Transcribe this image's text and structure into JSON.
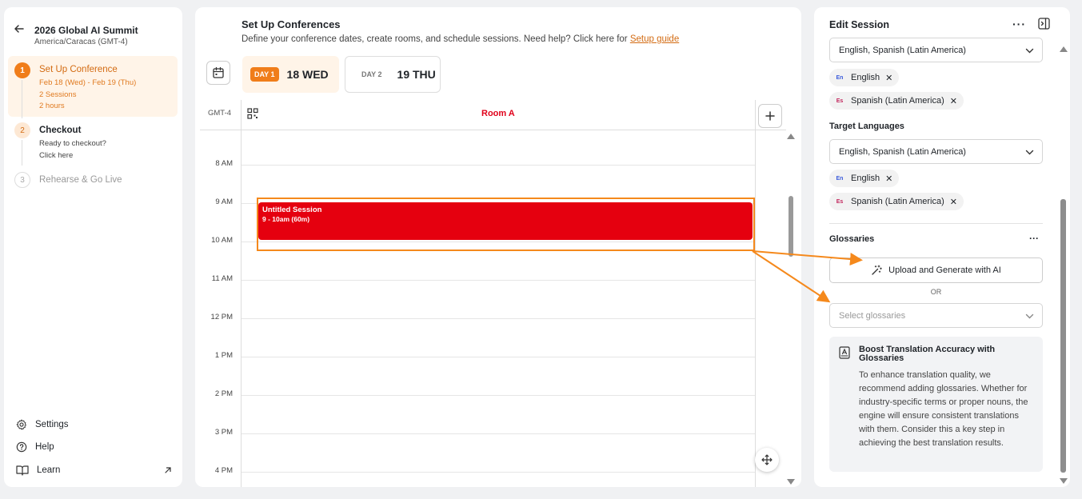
{
  "sidebar": {
    "conference_title": "2026 Global AI Summit",
    "timezone": "America/Caracas (GMT-4)",
    "steps": [
      {
        "num": "1",
        "title": "Set Up Conference",
        "sub1": "Feb 18 (Wed) - Feb 19 (Thu)",
        "sub2": "2 Sessions",
        "sub3": "2 hours"
      },
      {
        "num": "2",
        "title": "Checkout",
        "sub1": "Ready to checkout?",
        "sub2": "Click here"
      },
      {
        "num": "3",
        "title": "Rehearse & Go Live"
      }
    ],
    "bottom": {
      "settings": "Settings",
      "help": "Help",
      "learn": "Learn"
    }
  },
  "center": {
    "title": "Set Up Conferences",
    "description": "Define your conference dates, create rooms, and schedule sessions. Need help? Click here for",
    "setup_guide_link": "Setup guide",
    "days": [
      {
        "badge": "DAY 1",
        "date": "18 WED"
      },
      {
        "badge": "DAY 2",
        "date": "19 THU"
      }
    ],
    "timezone_label": "GMT-4",
    "room_name": "Room A",
    "times": [
      "8 AM",
      "9 AM",
      "10 AM",
      "11 AM",
      "12 PM",
      "1 PM",
      "2 PM",
      "3 PM",
      "4 PM"
    ],
    "session": {
      "title": "Untitled Session",
      "time": "9 - 10am (60m)"
    }
  },
  "right": {
    "title": "Edit Session",
    "source_select_value": "English, Spanish (Latin America)",
    "source_chips": [
      {
        "icon": "En",
        "label": "English"
      },
      {
        "icon": "Es",
        "label": "Spanish (Latin America)"
      }
    ],
    "target_label": "Target Languages",
    "target_select_value": "English, Spanish (Latin America)",
    "target_chips": [
      {
        "icon": "En",
        "label": "English"
      },
      {
        "icon": "Es",
        "label": "Spanish (Latin America)"
      }
    ],
    "glossaries_label": "Glossaries",
    "upload_button": "Upload and Generate with AI",
    "or_label": "OR",
    "select_glossaries_placeholder": "Select glossaries",
    "info_title": "Boost Translation Accuracy with Glossaries",
    "info_text": "To enhance translation quality, we recommend adding glossaries. Whether for industry-specific terms or proper nouns, the engine will ensure consistent translations with them. Consider this a key step in achieving the best translation results."
  },
  "colors": {
    "accent_orange": "#f07d1a",
    "session_red": "#e5000f",
    "room_red": "#e0001a"
  }
}
